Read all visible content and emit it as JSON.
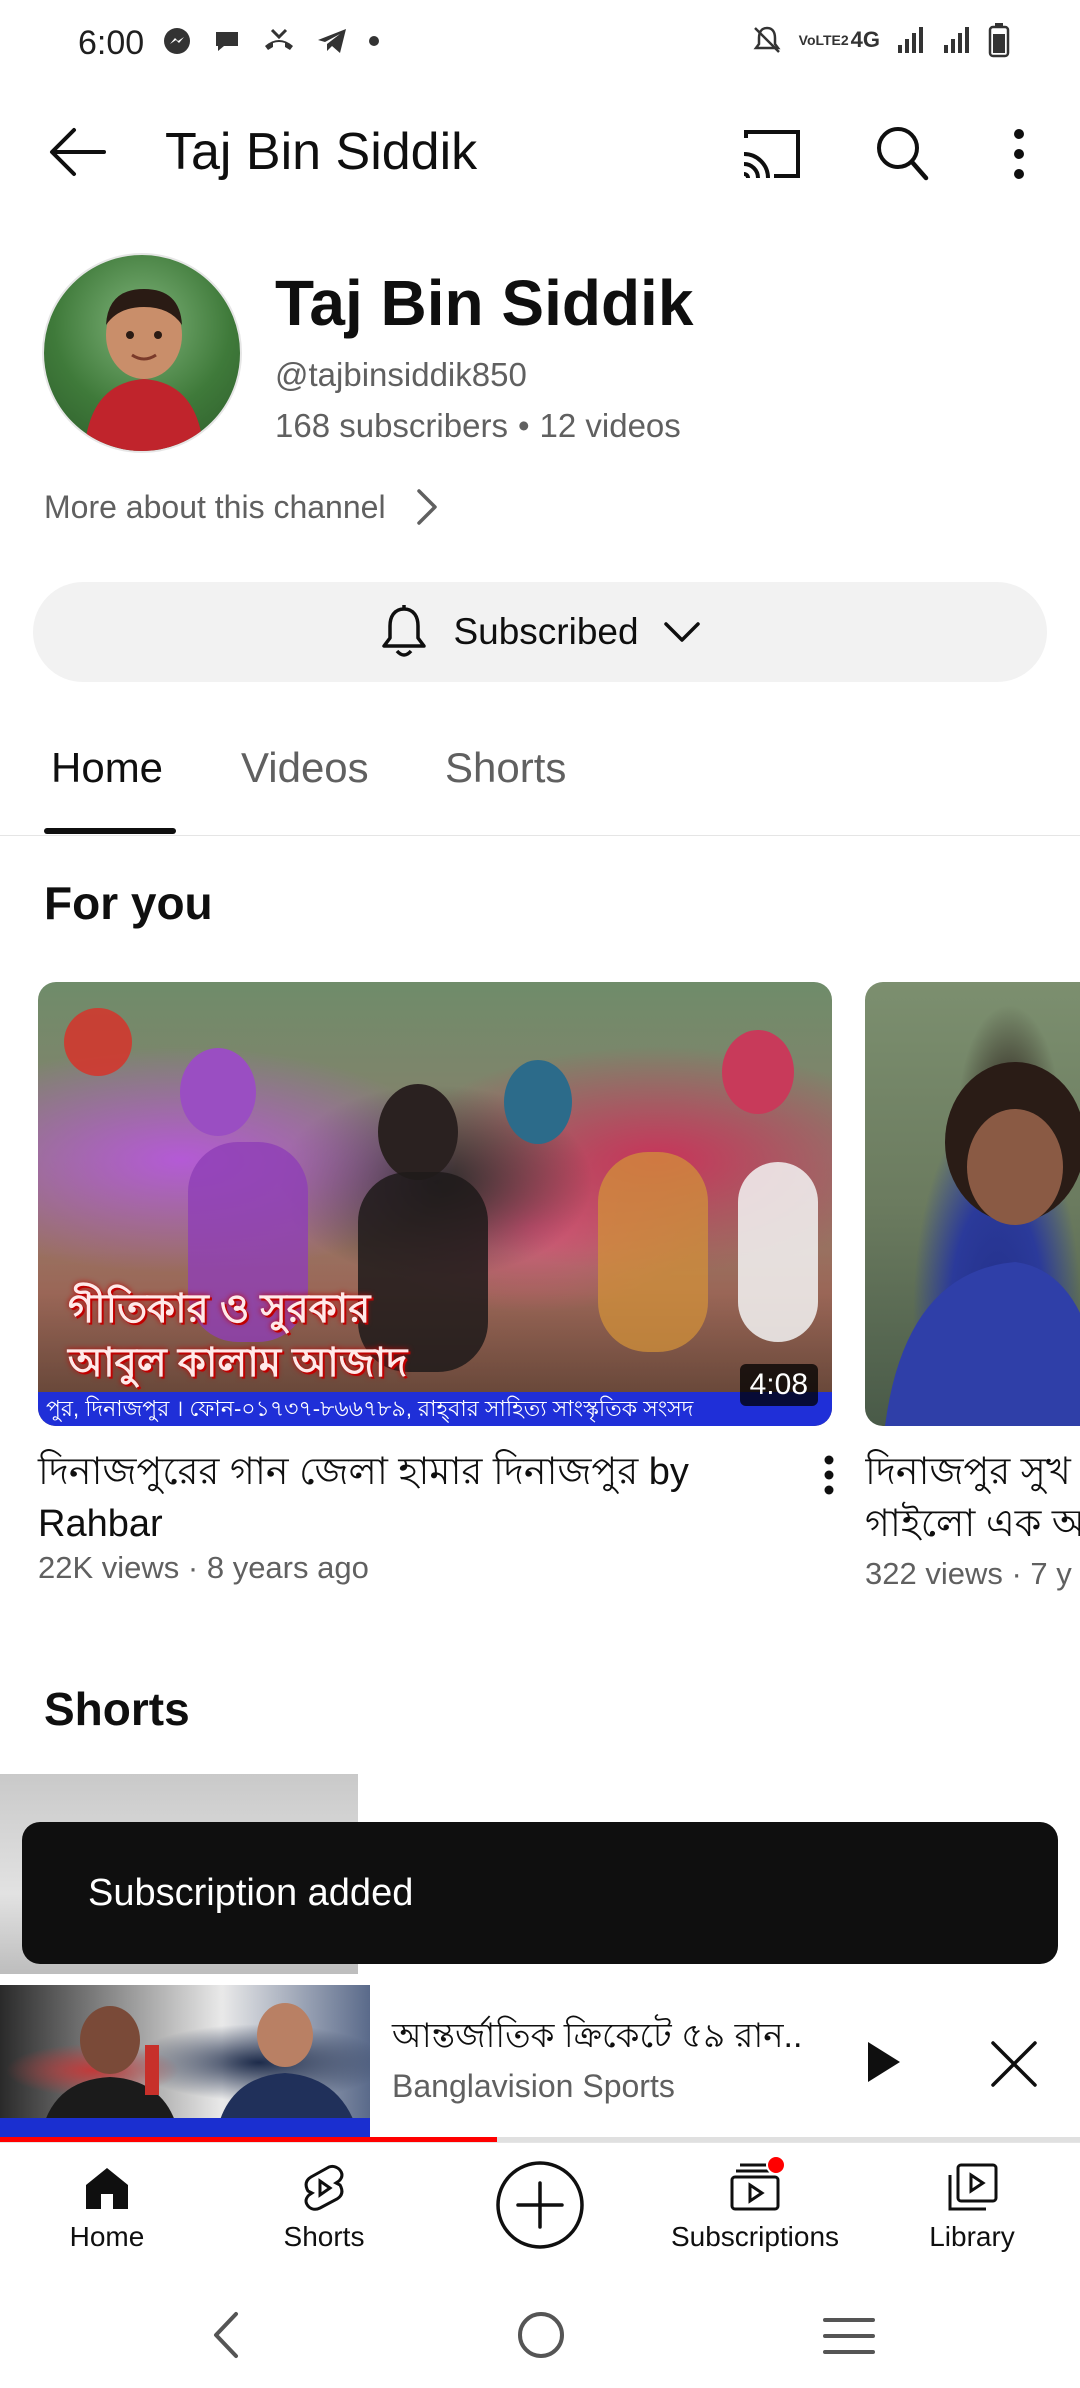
{
  "status_bar": {
    "time": "6:00",
    "left_icons": [
      "messenger-icon",
      "chat-icon",
      "missed-call-icon",
      "telegram-icon",
      "dot-icon"
    ],
    "right_icons": [
      "mute-icon",
      "volte-icon",
      "4g-icon",
      "signal-icon",
      "signal-icon",
      "battery-icon"
    ],
    "volte_label": "VoLTE2",
    "network_label": "4G"
  },
  "app_bar": {
    "title": "Taj Bin Siddik",
    "icons": [
      "back-arrow-icon",
      "cast-icon",
      "search-icon",
      "more-vert-icon"
    ]
  },
  "channel": {
    "name": "Taj Bin Siddik",
    "handle": "@tajbinsiddik850",
    "subscribers": "168 subscribers",
    "separator": "•",
    "videos": "12 videos",
    "more_about": "More about this channel"
  },
  "subscribe_button": {
    "label": "Subscribed"
  },
  "tabs": [
    {
      "label": "Home",
      "active": true
    },
    {
      "label": "Videos",
      "active": false
    },
    {
      "label": "Shorts",
      "active": false
    }
  ],
  "for_you": {
    "title": "For you",
    "videos": [
      {
        "title": "দিনাজপুরের গান জেলা হামার দিনাজপুর by Rahbar",
        "title_line1": "দিনাজপুরের গান জেলা হামার দিনাজপুর by",
        "title_line2": "Rahbar",
        "meta": "22K views · 8 years ago",
        "duration": "4:08",
        "thumb_caption_line1": "গীতিকার ও সুরকার",
        "thumb_caption_line2": "আবুল কালাম আজাদ",
        "thumb_ticker": "পুর, দিনাজপুর । ফোন-০১৭৩৭-৮৬৬৭৮৯, রাহ্‌বার সাহিত্য সাংস্কৃতিক সংসদ"
      },
      {
        "title_line1": "দিনাজপুর সুখ",
        "title_line2": "গাইলো এক অ",
        "meta": "322 views · 7 y"
      }
    ]
  },
  "shorts_section": {
    "title": "Shorts"
  },
  "toast": {
    "text": "Subscription added"
  },
  "mini_player": {
    "title": "আন্তর্জাতিক ক্রিকেটে ৫৯ রান..",
    "channel": "Banglavision Sports",
    "progress": 0.46
  },
  "bottom_nav": [
    {
      "label": "Home",
      "icon": "home-icon"
    },
    {
      "label": "Shorts",
      "icon": "shorts-icon"
    },
    {
      "label": "",
      "icon": "create-icon"
    },
    {
      "label": "Subscriptions",
      "icon": "subscriptions-icon",
      "badge": true
    },
    {
      "label": "Library",
      "icon": "library-icon"
    }
  ],
  "system_nav": [
    "back-icon",
    "home-circle-icon",
    "recents-icon"
  ],
  "colors": {
    "accent": "#ff0000",
    "text": "#0f0f0f",
    "secondary": "#606060",
    "chip_bg": "#f2f2f2",
    "toast_bg": "#0f0f0f"
  }
}
